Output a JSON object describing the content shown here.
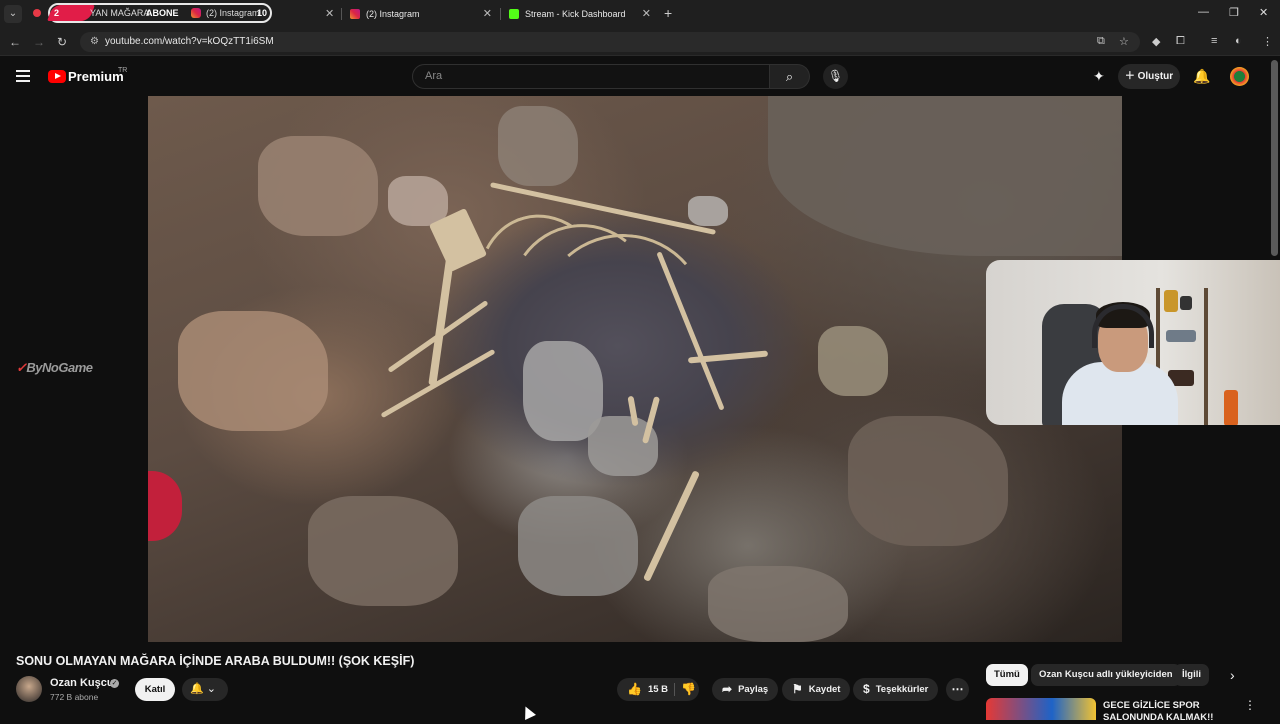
{
  "browser": {
    "tabs": [
      {
        "badge": "2",
        "title": "YAN MAĞARA",
        "extra": "ABONE",
        "sub_title": "(2) Instagram",
        "count": "10"
      },
      {
        "title": "(2) Instagram"
      },
      {
        "title": "Stream - Kick Dashboard"
      }
    ],
    "url": "youtube.com/watch?v=kOQzTT1i6SM"
  },
  "header": {
    "logo": "Premium",
    "region": "TR",
    "search_placeholder": "Ara",
    "create_label": "Oluştur"
  },
  "video": {
    "title": "SONU OLMAYAN MAĞARA İÇİNDE ARABA BULDUM!! (ŞOK KEŞİF)",
    "watermark": "ByNoGame"
  },
  "channel": {
    "name": "Ozan Kuşcu",
    "subscribers": "772 B abone",
    "join_label": "Katıl"
  },
  "actions": {
    "likes": "15 B",
    "share": "Paylaş",
    "save": "Kaydet",
    "thanks": "Teşekkürler"
  },
  "chips": [
    "Tümü",
    "Ozan Kuşcu adlı yükleyiciden",
    "İlgili"
  ],
  "recommendation": {
    "title": "GECE GİZLİCE SPOR SALONUNDA KALMAK!!"
  },
  "colors": {
    "accent": "#ff0000",
    "background": "#0f0f0f"
  }
}
